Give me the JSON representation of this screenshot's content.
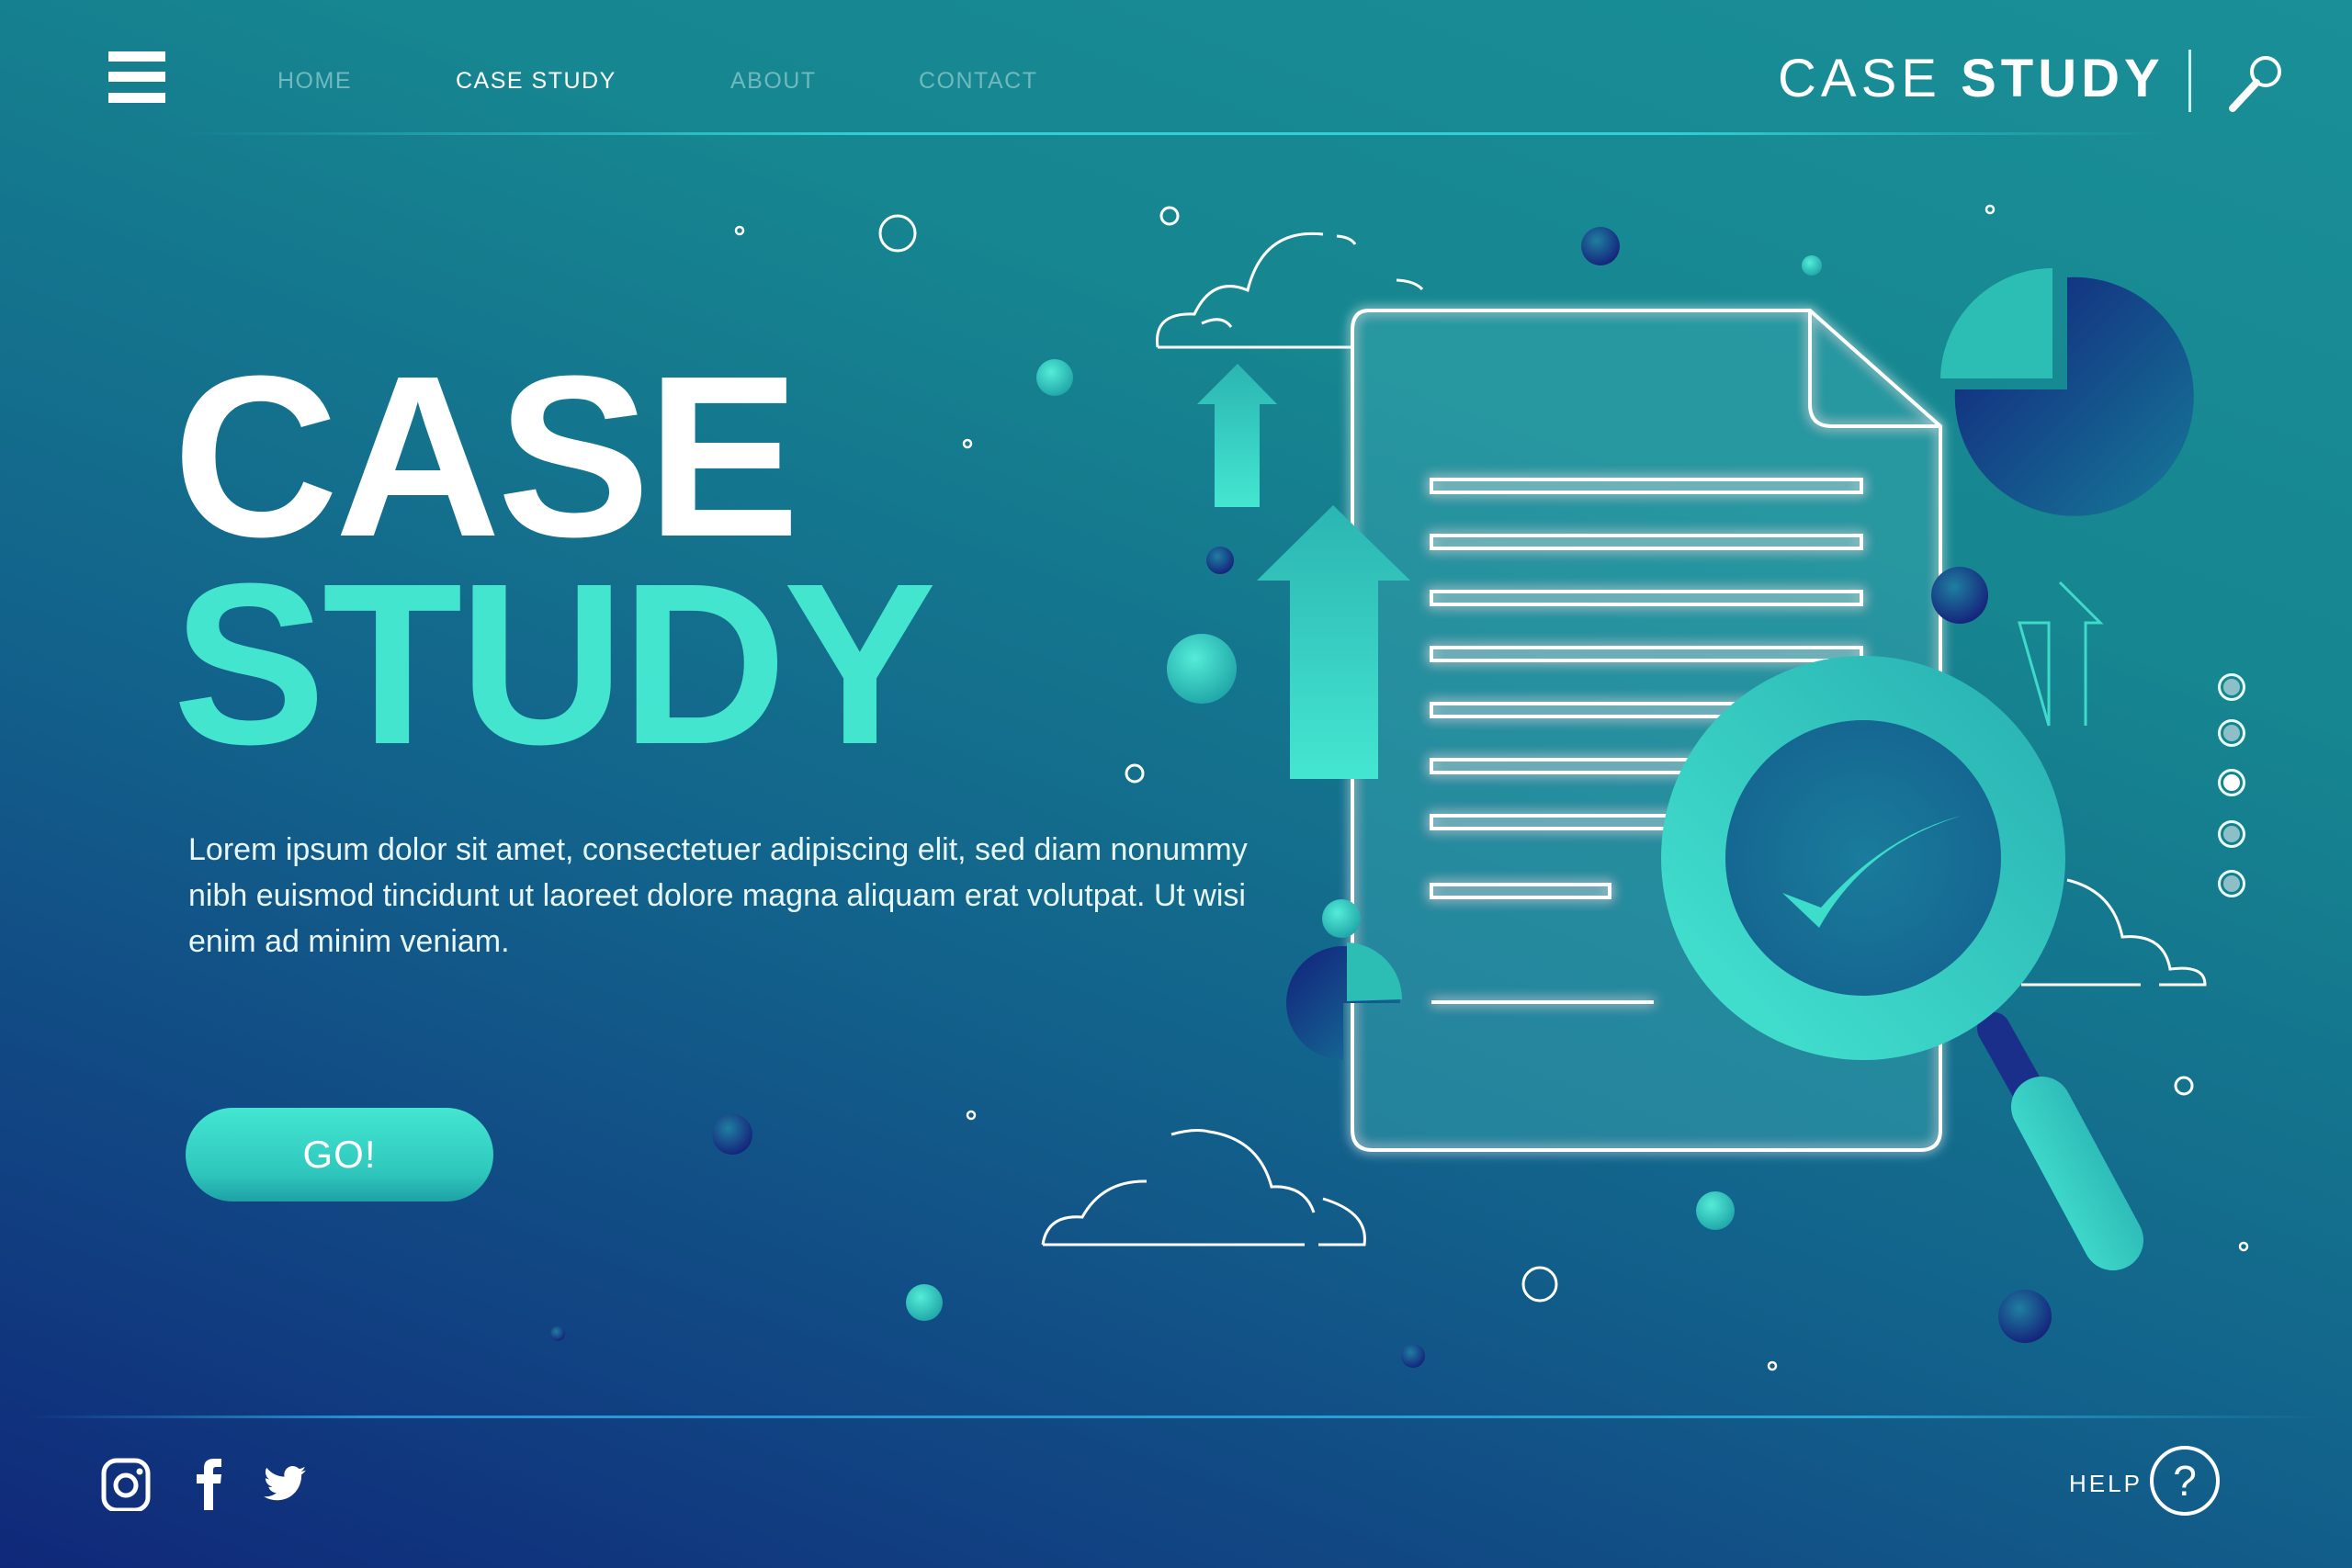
{
  "header": {
    "menu_icon": "hamburger-menu-icon",
    "nav": [
      {
        "label": "HOME",
        "active": false
      },
      {
        "label": "CASE STUDY",
        "active": true
      },
      {
        "label": "ABOUT",
        "active": false
      },
      {
        "label": "CONTACT",
        "active": false
      }
    ],
    "brand_light": "CASE",
    "brand_bold": "STUDY",
    "search_icon": "magnifier-icon"
  },
  "hero": {
    "title_line1": "CASE",
    "title_line2": "STUDY",
    "description": "Lorem ipsum dolor sit amet, consectetuer adipiscing elit, sed diam nonummy nibh euismod tincidunt ut laoreet dolore magna aliquam erat volutpat. Ut wisi enim ad minim veniam.",
    "cta_label": "GO!"
  },
  "pagination": {
    "total": 5,
    "active_index": 3
  },
  "footer": {
    "social": [
      {
        "name": "instagram",
        "icon": "instagram-icon"
      },
      {
        "name": "facebook",
        "icon": "facebook-icon"
      },
      {
        "name": "twitter",
        "icon": "twitter-icon"
      }
    ],
    "help_label": "HELP",
    "help_icon": "question-mark-icon",
    "help_glyph": "?"
  },
  "colors": {
    "accent_teal": "#43e5cf",
    "bg_top": "#1a8f97",
    "bg_bottom": "#10287a",
    "navy_sphere": "#16237e",
    "nav_inactive": "#6fb9bf"
  }
}
